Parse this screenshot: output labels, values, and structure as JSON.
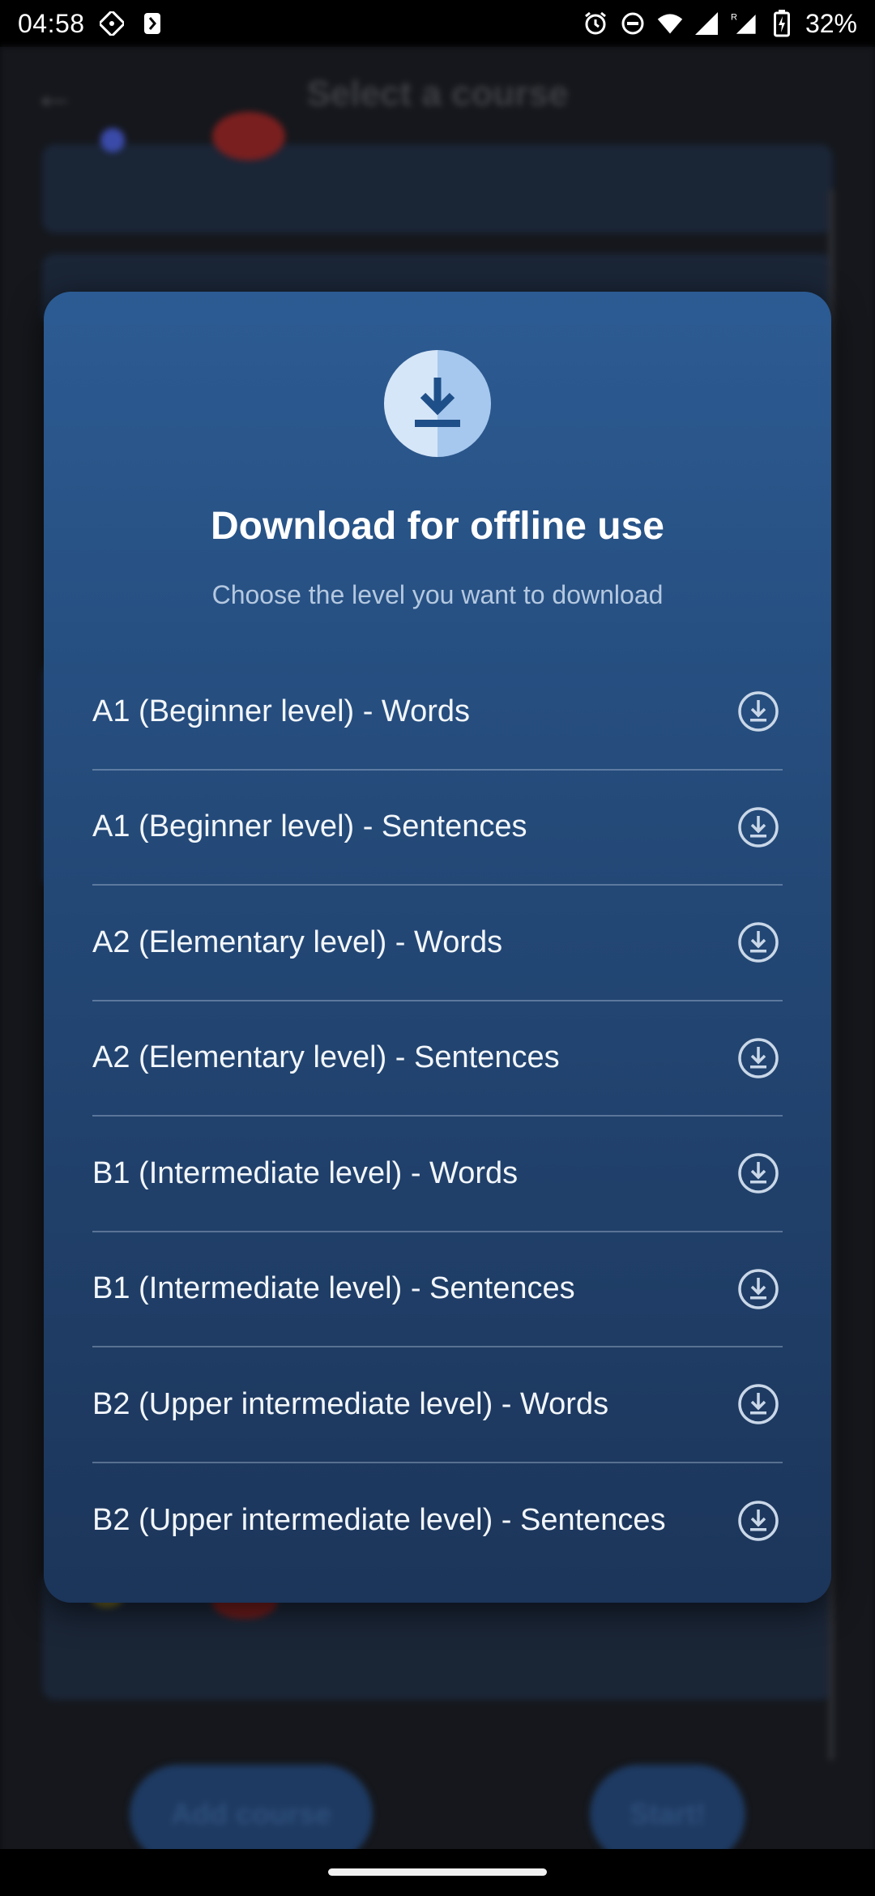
{
  "status_bar": {
    "time": "04:58",
    "battery": "32%"
  },
  "background_app": {
    "title": "Select a course",
    "add_course_label": "Add course",
    "start_label": "Start!"
  },
  "dialog": {
    "title": "Download for offline use",
    "subtitle": "Choose the level you want to download",
    "levels": [
      {
        "label": "A1 (Beginner level) - Words"
      },
      {
        "label": "A1 (Beginner level) - Sentences"
      },
      {
        "label": "A2 (Elementary level) - Words"
      },
      {
        "label": "A2 (Elementary level) - Sentences"
      },
      {
        "label": "B1 (Intermediate level) - Words"
      },
      {
        "label": "B1 (Intermediate level) - Sentences"
      },
      {
        "label": "B2 (Upper intermediate level) - Words"
      },
      {
        "label": "B2 (Upper intermediate level) - Sentences"
      }
    ]
  },
  "icons": {
    "header": "download-icon",
    "row": "download-circle-icon"
  },
  "colors": {
    "dialog_top": "#2c5b93",
    "dialog_bottom": "#1c355a",
    "badge_light": "#d5e6f8",
    "badge_dark": "#a6c8ee"
  }
}
